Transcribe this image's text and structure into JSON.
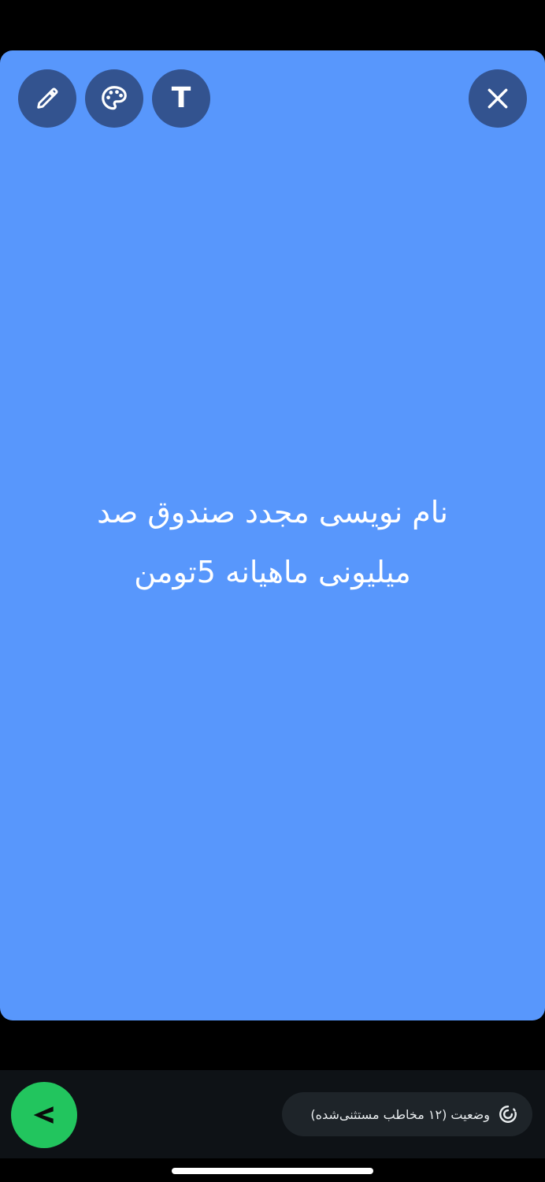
{
  "composer": {
    "background_color": "#5897FC",
    "text": "نام نویسی مجدد صندوق صد میلیونی ماهیانه 5تومن"
  },
  "toolbar": {
    "tools": [
      {
        "name": "pencil-icon"
      },
      {
        "name": "palette-icon"
      },
      {
        "name": "text-format-icon",
        "glyph": "T"
      }
    ],
    "close_icon": "close-icon"
  },
  "footer": {
    "privacy_label": "وضعیت (۱۲ مخاطب مستثنی‌شده)",
    "privacy_icon": "status-ring-icon",
    "send_icon": "send-arrow-icon",
    "send_color": "#22C55E"
  }
}
